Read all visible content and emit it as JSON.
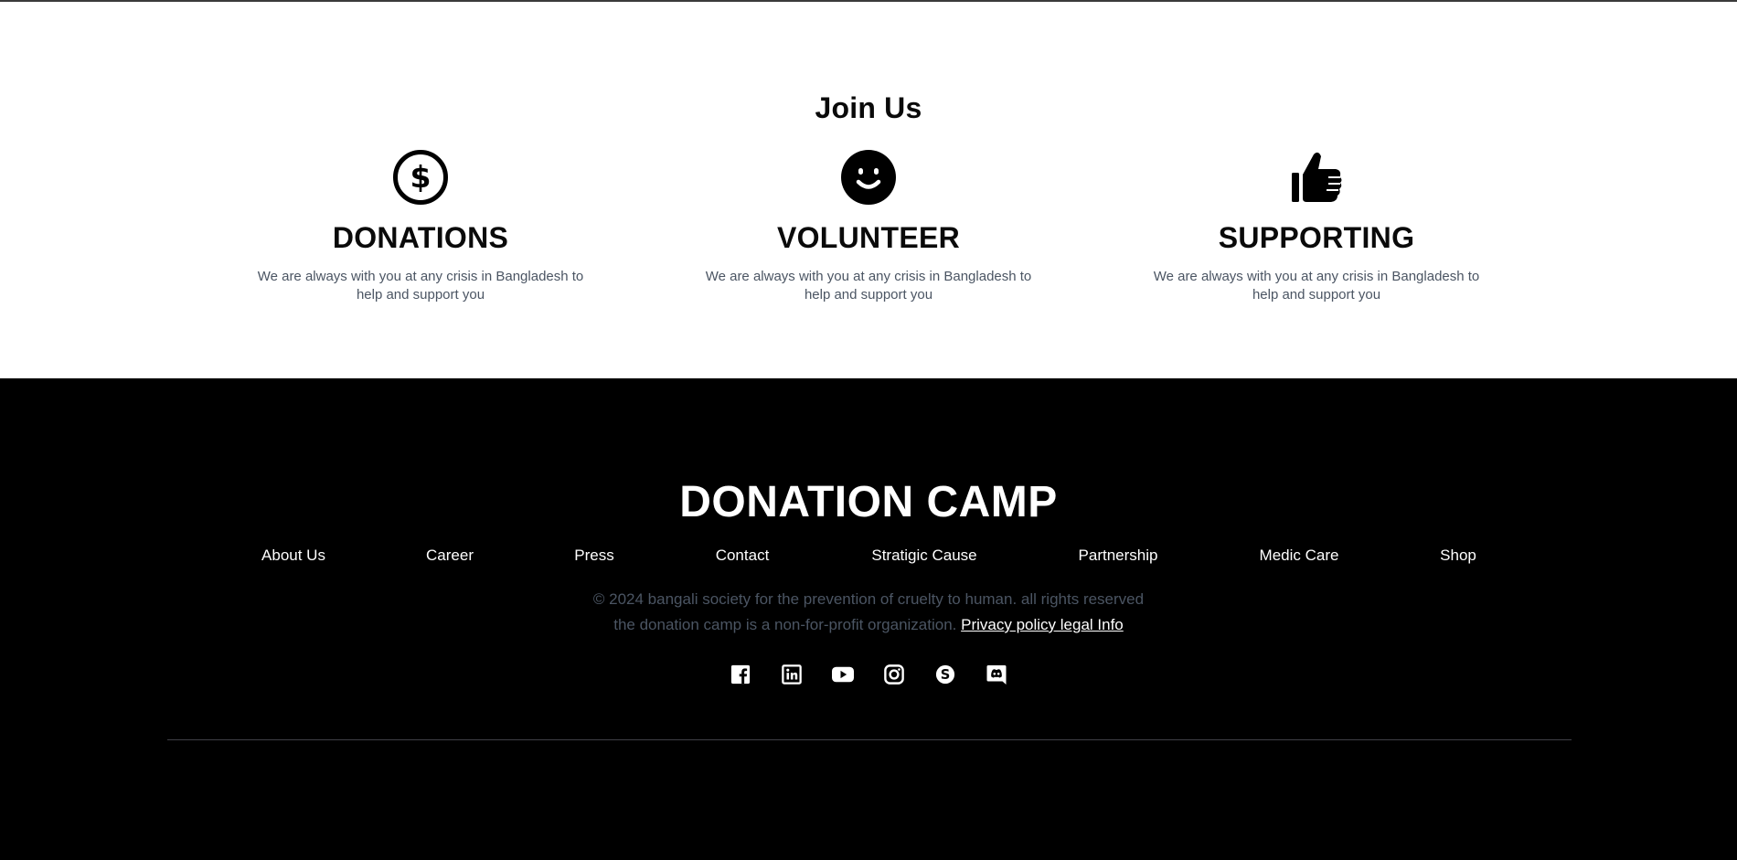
{
  "join": {
    "title": "Join Us",
    "cards": [
      {
        "icon": "dollar-circle-icon",
        "title": "DONATIONS",
        "description": "We are always with you at any crisis in Bangladesh to help and support you"
      },
      {
        "icon": "smiley-face-icon",
        "title": "VOLUNTEER",
        "description": "We are always with you at any crisis in Bangladesh to help and support you"
      },
      {
        "icon": "thumbs-up-icon",
        "title": "SUPPORTING",
        "description": "We are always with you at any crisis in Bangladesh to help and support you"
      }
    ]
  },
  "footer": {
    "brand": "DONATION CAMP",
    "nav": [
      "About Us",
      "Career",
      "Press",
      "Contact",
      "Stratigic Cause",
      "Partnership",
      "Medic Care",
      "Shop"
    ],
    "copyright": "© 2024 bangali society for the prevention of cruelty to human. all rights reserved",
    "nonprofit_text": "the donation camp is a non-for-profit organization.",
    "policy_link": "Privacy policy legal Info",
    "social": [
      "facebook-icon",
      "linkedin-icon",
      "youtube-icon",
      "instagram-icon",
      "skype-icon",
      "discord-icon"
    ]
  },
  "colors": {
    "footer_bg": "#000000",
    "muted_text": "#4b5563",
    "heading_text": "#0a0a0a"
  }
}
